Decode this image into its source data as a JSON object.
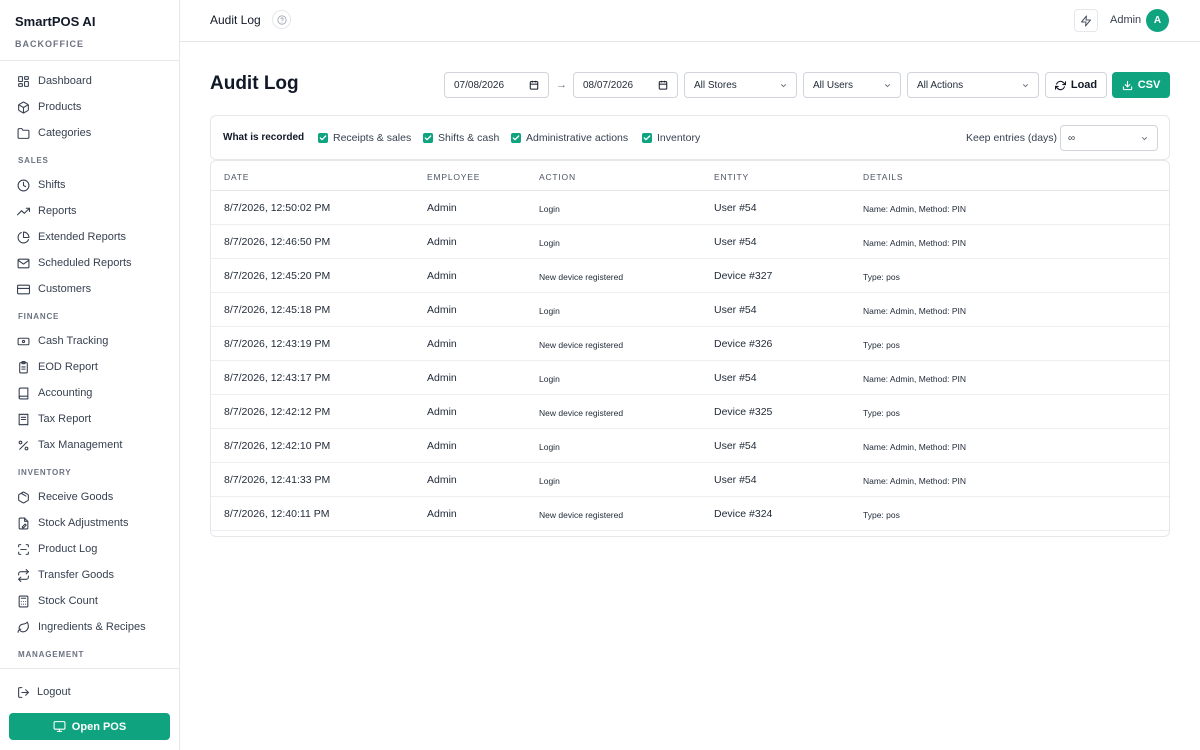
{
  "app": {
    "name": "SmartPOS AI",
    "subtitle": "BACKOFFICE"
  },
  "sidebar": {
    "top_items": [
      {
        "label": "Dashboard",
        "icon": "grid-icon"
      },
      {
        "label": "Products",
        "icon": "box-icon"
      },
      {
        "label": "Categories",
        "icon": "folder-icon"
      }
    ],
    "sections": [
      {
        "title": "SALES",
        "items": [
          {
            "label": "Shifts",
            "icon": "clock-icon"
          },
          {
            "label": "Reports",
            "icon": "trending-up-icon"
          },
          {
            "label": "Extended Reports",
            "icon": "pie-chart-icon"
          },
          {
            "label": "Scheduled Reports",
            "icon": "mail-icon"
          },
          {
            "label": "Customers",
            "icon": "credit-card-icon"
          }
        ]
      },
      {
        "title": "FINANCE",
        "items": [
          {
            "label": "Cash Tracking",
            "icon": "banknote-icon"
          },
          {
            "label": "EOD Report",
            "icon": "clipboard-icon"
          },
          {
            "label": "Accounting",
            "icon": "book-icon"
          },
          {
            "label": "Tax Report",
            "icon": "receipt-icon"
          },
          {
            "label": "Tax Management",
            "icon": "percent-icon"
          }
        ]
      },
      {
        "title": "INVENTORY",
        "items": [
          {
            "label": "Receive Goods",
            "icon": "package-icon"
          },
          {
            "label": "Stock Adjustments",
            "icon": "file-edit-icon"
          },
          {
            "label": "Product Log",
            "icon": "scan-icon"
          },
          {
            "label": "Transfer Goods",
            "icon": "arrows-icon"
          },
          {
            "label": "Stock Count",
            "icon": "calculator-icon"
          },
          {
            "label": "Ingredients & Recipes",
            "icon": "leaf-icon"
          }
        ]
      },
      {
        "title": "MANAGEMENT",
        "items": []
      }
    ],
    "logout": "Logout",
    "open_pos": "Open POS"
  },
  "topbar": {
    "title": "Audit Log",
    "user": "Admin",
    "avatar_initial": "A"
  },
  "page": {
    "title": "Audit Log",
    "date_from": "07/08/2026",
    "date_to": "08/07/2026",
    "date_sep": "→",
    "stores": "All Stores",
    "users": "All Users",
    "actions": "All Actions",
    "load_label": "Load",
    "csv_label": "CSV"
  },
  "recorded": {
    "label": "What is recorded",
    "options": [
      {
        "label": "Receipts & sales",
        "checked": true
      },
      {
        "label": "Shifts & cash",
        "checked": true
      },
      {
        "label": "Administrative actions",
        "checked": true
      },
      {
        "label": "Inventory",
        "checked": true
      }
    ],
    "keep_label": "Keep entries (days)",
    "keep_value": "∞"
  },
  "table": {
    "headers": [
      "DATE",
      "EMPLOYEE",
      "ACTION",
      "ENTITY",
      "DETAILS"
    ],
    "rows": [
      [
        "8/7/2026, 12:50:02 PM",
        "Admin",
        "Login",
        "User #54",
        "Name: Admin, Method: PIN"
      ],
      [
        "8/7/2026, 12:46:50 PM",
        "Admin",
        "Login",
        "User #54",
        "Name: Admin, Method: PIN"
      ],
      [
        "8/7/2026, 12:45:20 PM",
        "Admin",
        "New device registered",
        "Device #327",
        "Type: pos"
      ],
      [
        "8/7/2026, 12:45:18 PM",
        "Admin",
        "Login",
        "User #54",
        "Name: Admin, Method: PIN"
      ],
      [
        "8/7/2026, 12:43:19 PM",
        "Admin",
        "New device registered",
        "Device #326",
        "Type: pos"
      ],
      [
        "8/7/2026, 12:43:17 PM",
        "Admin",
        "Login",
        "User #54",
        "Name: Admin, Method: PIN"
      ],
      [
        "8/7/2026, 12:42:12 PM",
        "Admin",
        "New device registered",
        "Device #325",
        "Type: pos"
      ],
      [
        "8/7/2026, 12:42:10 PM",
        "Admin",
        "Login",
        "User #54",
        "Name: Admin, Method: PIN"
      ],
      [
        "8/7/2026, 12:41:33 PM",
        "Admin",
        "Login",
        "User #54",
        "Name: Admin, Method: PIN"
      ],
      [
        "8/7/2026, 12:40:11 PM",
        "Admin",
        "New device registered",
        "Device #324",
        "Type: pos"
      ]
    ]
  },
  "colors": {
    "accent": "#10a37f",
    "border": "#e5e7eb",
    "text": "#1f2937"
  }
}
